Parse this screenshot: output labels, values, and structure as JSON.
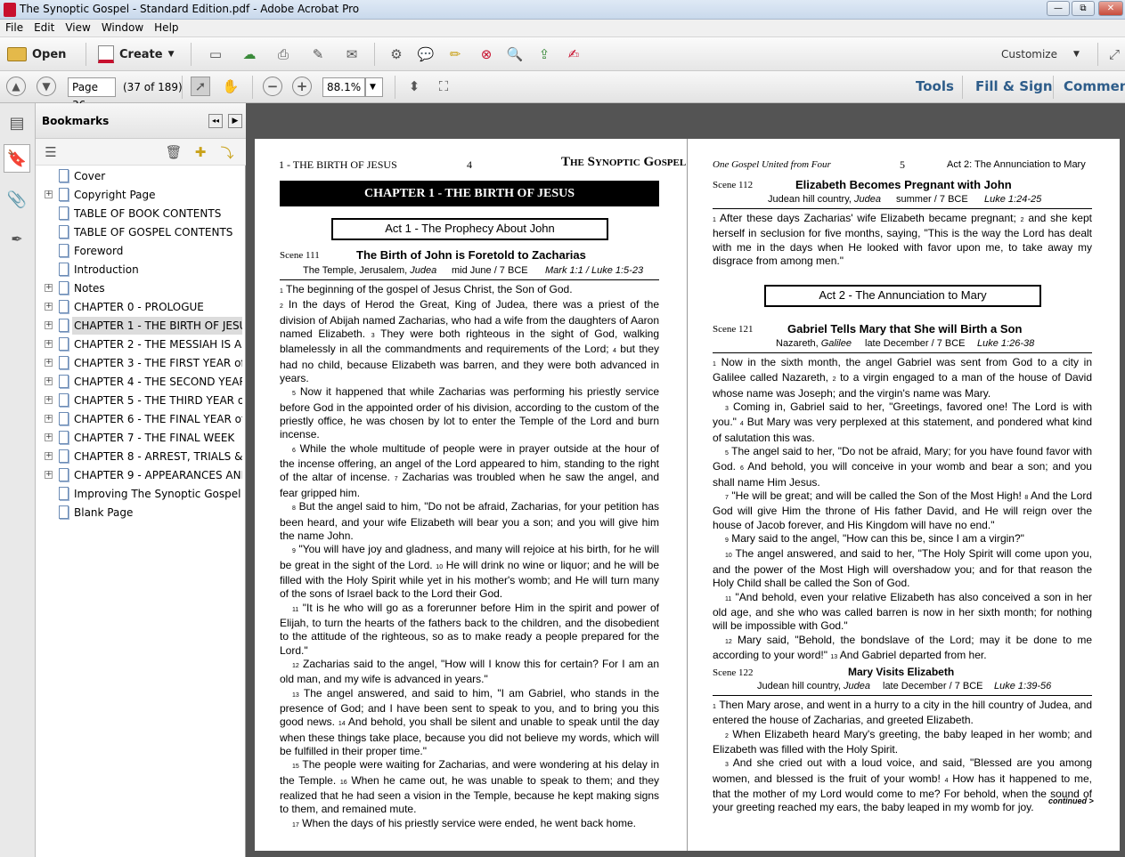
{
  "window": {
    "title": "The Synoptic Gospel - Standard Edition.pdf - Adobe Acrobat Pro",
    "minimize": "—",
    "restore": "⧉",
    "close": "✕"
  },
  "menu": [
    "File",
    "Edit",
    "View",
    "Window",
    "Help"
  ],
  "toolbar": {
    "open": "Open",
    "create": "Create",
    "customize": "Customize"
  },
  "nav": {
    "page_value": "Page 36",
    "page_count": "(37 of 189)",
    "zoom": "88.1%",
    "tools": "Tools",
    "fill_sign": "Fill & Sign",
    "comment": "Comment"
  },
  "bookmarks": {
    "title": "Bookmarks",
    "collapse": "◂◂",
    "items": [
      {
        "label": "Cover",
        "expandable": false
      },
      {
        "label": "Copyright Page",
        "expandable": true
      },
      {
        "label": "TABLE OF BOOK CONTENTS",
        "expandable": false
      },
      {
        "label": "TABLE OF GOSPEL CONTENTS",
        "expandable": false
      },
      {
        "label": "Foreword",
        "expandable": false
      },
      {
        "label": "Introduction",
        "expandable": false
      },
      {
        "label": "Notes",
        "expandable": true
      },
      {
        "label": "CHAPTER 0 - PROLOGUE",
        "expandable": true
      },
      {
        "label": "CHAPTER 1 - THE BIRTH OF JESUS",
        "expandable": true,
        "selected": true
      },
      {
        "label": "CHAPTER 2 - THE MESSIAH IS ANC",
        "expandable": true
      },
      {
        "label": "CHAPTER 3 - THE FIRST YEAR of H",
        "expandable": true
      },
      {
        "label": "CHAPTER 4 - THE SECOND YEAR o",
        "expandable": true
      },
      {
        "label": "CHAPTER 5 - THE THIRD YEAR of H",
        "expandable": true
      },
      {
        "label": "CHAPTER 6 - THE FINAL YEAR of H",
        "expandable": true
      },
      {
        "label": "CHAPTER 7 - THE FINAL WEEK",
        "expandable": true
      },
      {
        "label": "CHAPTER 8 - ARREST, TRIALS & CR",
        "expandable": true
      },
      {
        "label": "CHAPTER 9 - APPEARANCES AND",
        "expandable": true
      },
      {
        "label": "Improving The Synoptic Gospel",
        "expandable": false
      },
      {
        "label": "Blank Page",
        "expandable": false
      }
    ]
  },
  "left_page": {
    "running_head": "1 - THE BIRTH OF JESUS",
    "page_number": "4",
    "logo": "The Synoptic Gospel",
    "chapter_banner": "CHAPTER 1 - THE BIRTH OF JESUS",
    "act_box": "Act 1 - The Prophecy About John",
    "scene": {
      "label": "Scene 111",
      "title": "The Birth of John is Foretold to Zacharias",
      "place": "The Temple, Jerusalem, ",
      "region": "Judea",
      "time": "mid June / 7 BCE",
      "refs": "Mark 1:1 / Luke 1:5-23"
    }
  },
  "right_page": {
    "running_head_left": "One Gospel United from Four",
    "page_number": "5",
    "running_head_right": "Act 2: The Annunciation to Mary",
    "scene1": {
      "label": "Scene 112",
      "title": "Elizabeth Becomes Pregnant with John",
      "place": "Judean hill country, ",
      "region": "Judea",
      "time": "summer / 7 BCE",
      "refs": "Luke 1:24-25"
    },
    "act_box": "Act 2 - The Annunciation to Mary",
    "scene2": {
      "label": "Scene 121",
      "title": "Gabriel Tells Mary that She will Birth a Son",
      "place": "Nazareth, ",
      "region": "Galilee",
      "time": "late December / 7 BCE",
      "refs": "Luke 1:26-38"
    },
    "scene3": {
      "label": "Scene 122",
      "title": "Mary Visits Elizabeth",
      "place": "Judean hill country, ",
      "region": "Judea",
      "time": "late December / 7 BCE",
      "refs": "Luke 1:39-56"
    },
    "continued": "continued >"
  },
  "colors": {
    "banner": "#000000",
    "link": "#2e5d8a",
    "viewer_bg": "#545454"
  }
}
